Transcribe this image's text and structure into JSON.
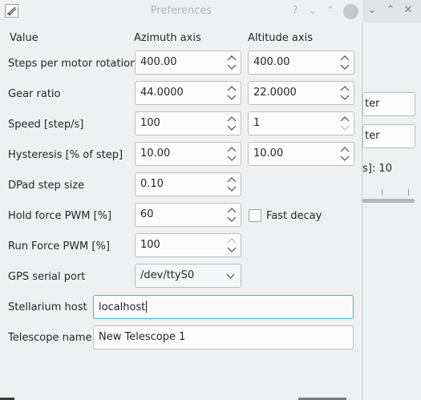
{
  "window": {
    "title": "Preferences"
  },
  "headers": {
    "value": "Value",
    "azimuth": "Azimuth axis",
    "altitude": "Altitude axis"
  },
  "rows": {
    "steps": {
      "label": "Steps per motor rotation",
      "azimuth": "400.00",
      "altitude": "400.00"
    },
    "gear": {
      "label": "Gear ratio",
      "azimuth": "44.0000",
      "altitude": "22.0000"
    },
    "speed": {
      "label": "Speed [step/s]",
      "azimuth": "100",
      "altitude": "1"
    },
    "hysteresis": {
      "label": "Hysteresis [% of step]",
      "azimuth": "10.00",
      "altitude": "10.00"
    },
    "dpad": {
      "label": "DPad step size",
      "value": "0.10"
    },
    "hold": {
      "label": "Hold force PWM [%]",
      "value": "60",
      "checkbox_label": "Fast decay",
      "checkbox_checked": false
    },
    "run": {
      "label": "Run Force PWM [%]",
      "value": "100"
    },
    "gps": {
      "label": "GPS serial port",
      "value": "/dev/ttyS0"
    },
    "stellarium": {
      "label": "Stellarium host",
      "value": "localhost"
    },
    "telescope": {
      "label": "Telescope name",
      "value": "New Telescope 1"
    }
  },
  "background_window": {
    "button1_label": "ter",
    "button2_label": "ter",
    "status_text": "s]: 10"
  },
  "icons": {
    "app": "telescope-icon",
    "help": "question-icon",
    "minimize": "chevron-down-icon",
    "maximize": "chevron-up-icon",
    "close": "close-icon"
  },
  "colors": {
    "focus": "#3daee9",
    "background": "#eff0f1",
    "field": "#fcfcfc"
  }
}
